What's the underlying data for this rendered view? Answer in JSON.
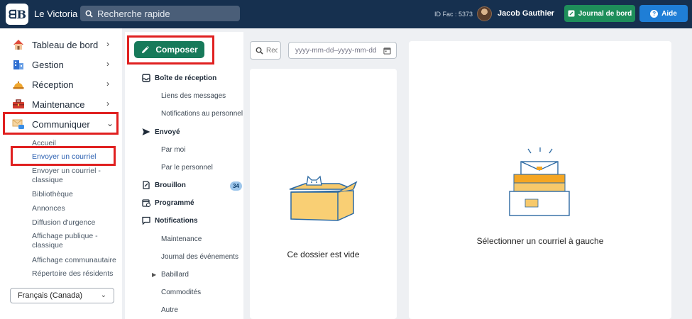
{
  "header": {
    "app_name": "Le Victoria",
    "logo_text": "ꟾB",
    "search_placeholder": "Recherche rapide",
    "id_fac": "ID Fac : 5373",
    "user_name": "Jacob Gauthier",
    "journal_label": "Journal de bord",
    "aide_label": "Aide"
  },
  "sidebar": {
    "items": [
      {
        "label": "Tableau de bord",
        "icon": "house-icon"
      },
      {
        "label": "Gestion",
        "icon": "building-icon"
      },
      {
        "label": "Réception",
        "icon": "service-bell-icon"
      },
      {
        "label": "Maintenance",
        "icon": "toolbox-icon"
      },
      {
        "label": "Communiquer",
        "icon": "envelope-chat-icon"
      }
    ],
    "sub_items": [
      "Accueil",
      "Envoyer un courriel",
      "Envoyer un courriel - classique",
      "Bibliothèque",
      "Annonces",
      "Diffusion d'urgence",
      "Affichage publique - classique",
      "Affichage communautaire",
      "Répertoire des résidents"
    ],
    "language": "Français (Canada)"
  },
  "folders": {
    "compose_label": "Composer",
    "inbox": "Boîte de réception",
    "inbox_subs": [
      "Liens des messages",
      "Notifications au personnel"
    ],
    "sent": "Envoyé",
    "sent_subs": [
      "Par moi",
      "Par le personnel"
    ],
    "draft": "Brouillon",
    "draft_count": "34",
    "scheduled": "Programmé",
    "notifications": "Notifications",
    "notification_subs": [
      "Maintenance",
      "Journal des événements",
      "Babillard",
      "Commodités",
      "Autre"
    ]
  },
  "filters": {
    "search_placeholder": "Rechercher",
    "date_placeholder": "yyyy-mm-dd–yyyy-mm-dd"
  },
  "list": {
    "empty_text": "Ce dossier est vide"
  },
  "detail": {
    "empty_text": "Sélectionner un courriel à gauche"
  },
  "colors": {
    "topbar": "#16304f",
    "compose": "#177a5a",
    "journal": "#1e8e5a",
    "aide": "#1f7ed6",
    "highlight": "#e02020"
  }
}
